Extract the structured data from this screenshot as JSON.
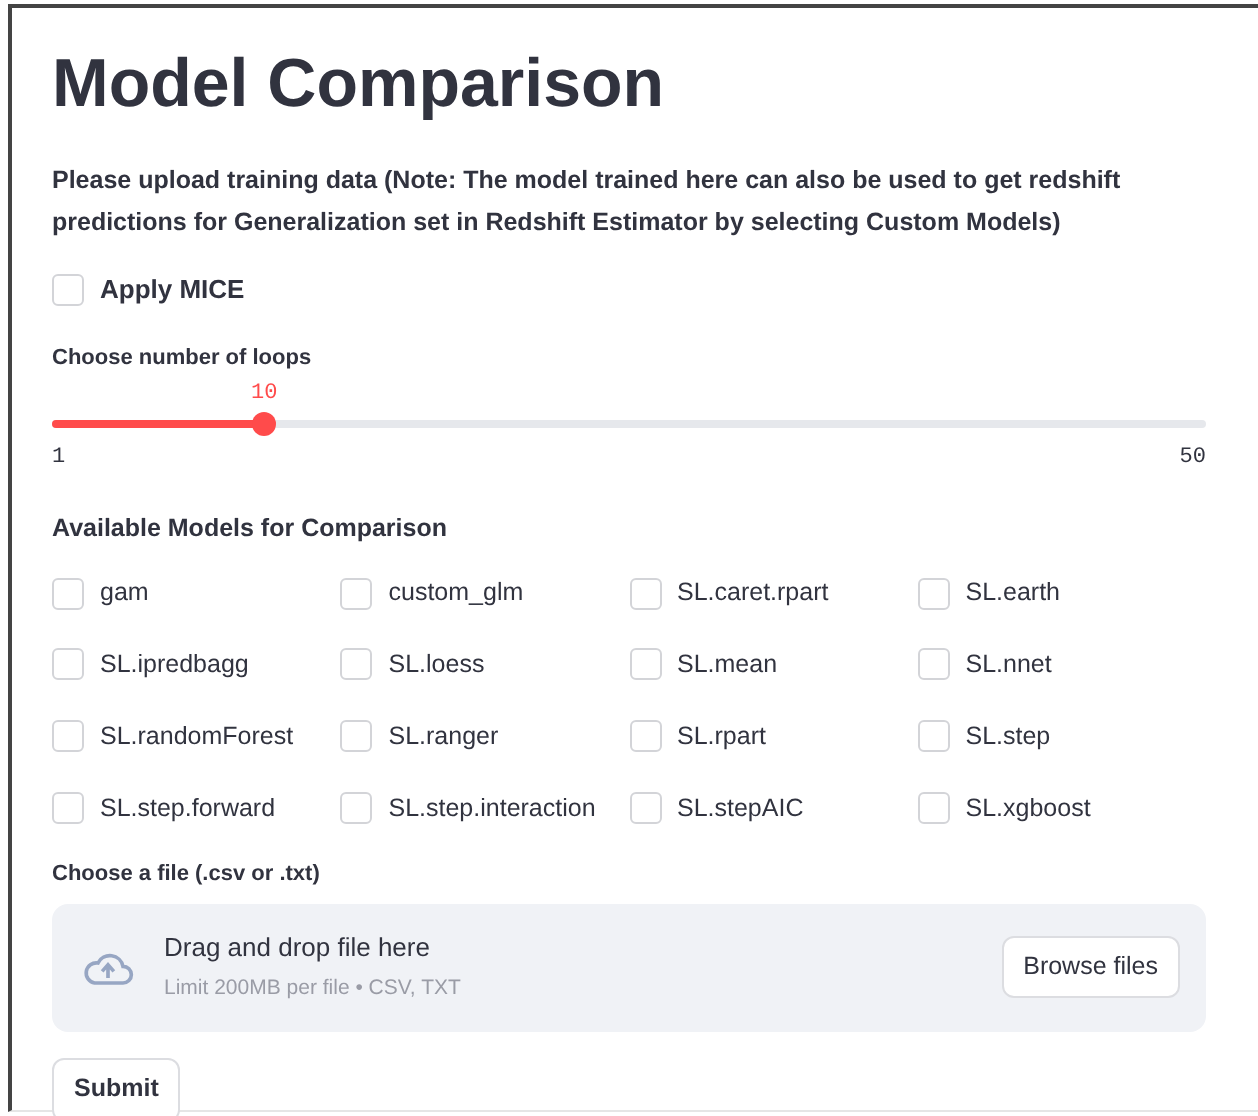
{
  "title": "Model Comparison",
  "description": "Please upload training data (Note: The model trained here can also be used to get redshift predictions for Generalization set in Redshift Estimator by selecting Custom Models)",
  "apply_mice": {
    "label": "Apply MICE",
    "checked": false
  },
  "loops_slider": {
    "label": "Choose number of loops",
    "value": "10",
    "min": "1",
    "max": "50",
    "level": 0.184
  },
  "models": {
    "heading": "Available Models for Comparison",
    "items": [
      {
        "label": "gam",
        "checked": false
      },
      {
        "label": "custom_glm",
        "checked": false
      },
      {
        "label": "SL.caret.rpart",
        "checked": false
      },
      {
        "label": "SL.earth",
        "checked": false
      },
      {
        "label": "SL.ipredbagg",
        "checked": false
      },
      {
        "label": "SL.loess",
        "checked": false
      },
      {
        "label": "SL.mean",
        "checked": false
      },
      {
        "label": "SL.nnet",
        "checked": false
      },
      {
        "label": "SL.randomForest",
        "checked": false
      },
      {
        "label": "SL.ranger",
        "checked": false
      },
      {
        "label": "SL.rpart",
        "checked": false
      },
      {
        "label": "SL.step",
        "checked": false
      },
      {
        "label": "SL.step.forward",
        "checked": false
      },
      {
        "label": "SL.step.interaction",
        "checked": false
      },
      {
        "label": "SL.stepAIC",
        "checked": false
      },
      {
        "label": "SL.xgboost",
        "checked": false
      }
    ]
  },
  "file_upload": {
    "label": "Choose a file (.csv or .txt)",
    "drop_text": "Drag and drop file here",
    "limit_text": "Limit 200MB per file • CSV, TXT",
    "browse_button": "Browse files"
  },
  "submit_button": "Submit"
}
